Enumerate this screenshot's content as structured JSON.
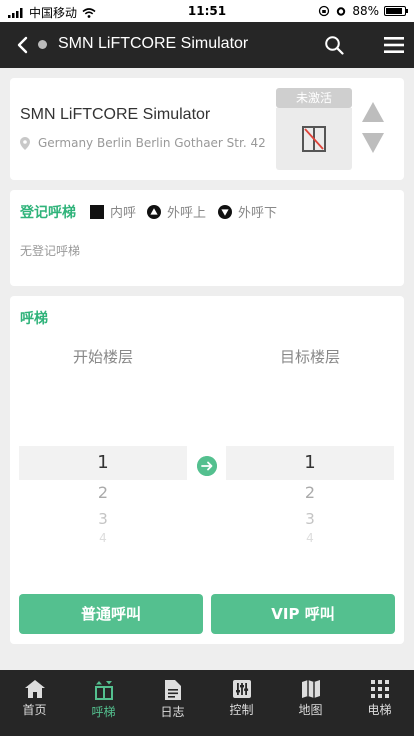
{
  "status_bar": {
    "carrier": "中国移动",
    "time": "11:51",
    "battery": "88%",
    "battery_level": 0.88
  },
  "nav": {
    "title": "SMN LiFTCORE Simulator"
  },
  "elevator": {
    "name": "SMN LiFTCORE Simulator",
    "address": "Germany Berlin Berlin Gothaer Str. 42",
    "status": "未激活"
  },
  "registered": {
    "title": "登记呼梯",
    "legend_inner": "内呼",
    "legend_up": "外呼上",
    "legend_down": "外呼下",
    "empty_text": "无登记呼梯"
  },
  "call": {
    "title": "呼梯",
    "start_label": "开始楼层",
    "target_label": "目标楼层",
    "start_options": [
      "1",
      "2",
      "3",
      "4"
    ],
    "target_options": [
      "1",
      "2",
      "3",
      "4"
    ],
    "normal_button": "普通呼叫",
    "vip_button": "VIP 呼叫"
  },
  "tabs": [
    {
      "label": "首页",
      "icon": "home-icon"
    },
    {
      "label": "呼梯",
      "icon": "elevator-call-icon"
    },
    {
      "label": "日志",
      "icon": "log-icon"
    },
    {
      "label": "控制",
      "icon": "control-icon"
    },
    {
      "label": "地图",
      "icon": "map-icon"
    },
    {
      "label": "电梯",
      "icon": "grid-icon"
    }
  ],
  "active_tab": "呼梯",
  "colors": {
    "accent": "#54c08f",
    "heading": "#2fb37a",
    "navbar": "#262626"
  }
}
